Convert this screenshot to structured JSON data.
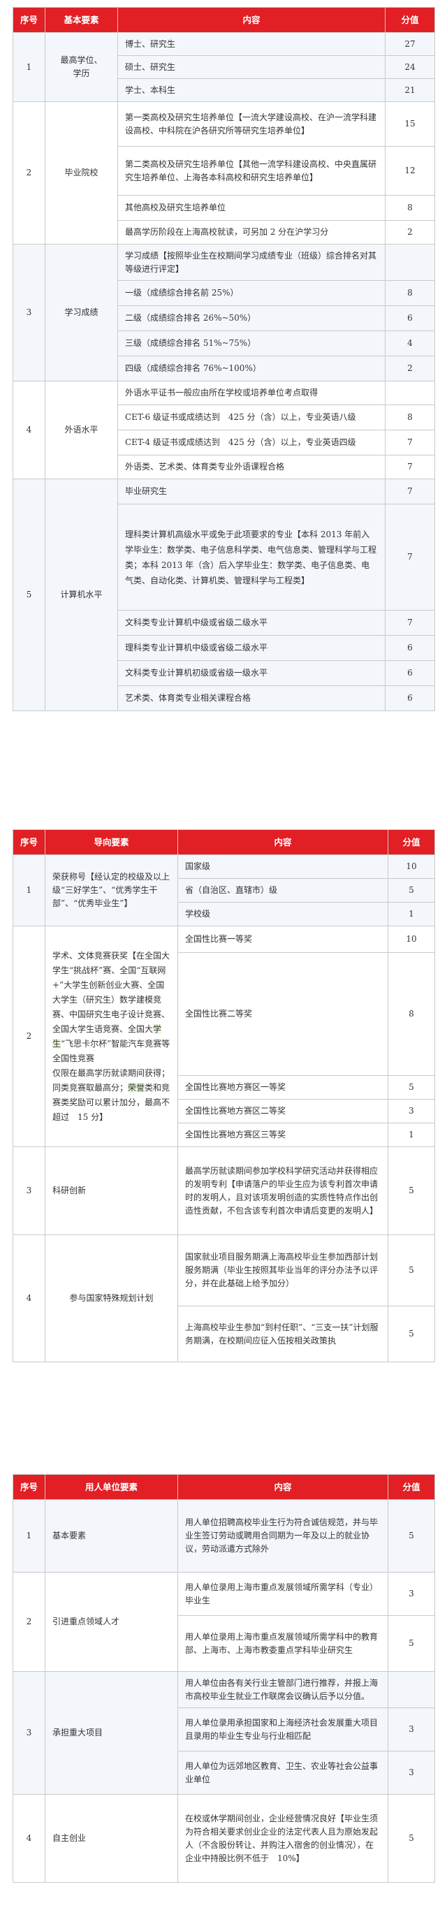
{
  "t1": {
    "headers": [
      "序号",
      "基本要素",
      "内容",
      "分值"
    ],
    "groups": [
      {
        "no": "1",
        "name": "最高学位、\n学历",
        "rows": [
          [
            "博士、研究生",
            "27"
          ],
          [
            "硕士、研究生",
            "24"
          ],
          [
            "学士、本科生",
            "21"
          ]
        ]
      },
      {
        "no": "2",
        "name": "毕业院校",
        "rows": [
          [
            "第一类高校及研究生培养单位【一流大学建设高校、在沪一流学科建设高校、中科院在沪各研究所等研究生培养单位】",
            "15"
          ],
          [
            "第二类高校及研究生培养单位【其他一流学科建设高校、中央直属研究生培养单位、上海各本科高校和研究生培养单位】",
            "12"
          ],
          [
            "其他高校及研究生培养单位",
            "8"
          ],
          [
            "最高学历阶段在上海高校就读，可另加 2 分在沪学习分",
            "2"
          ]
        ]
      },
      {
        "no": "3",
        "name": "学习成绩",
        "rows": [
          [
            "学习成绩【按照毕业生在校期间学习成绩专业（班级）综合排名对其等级进行评定】",
            ""
          ],
          [
            "一级（成绩综合排名前 25%）",
            "8"
          ],
          [
            "二级（成绩综合排名 26%~50%）",
            "6"
          ],
          [
            "三级（成绩综合排名 51%~75%）",
            "4"
          ],
          [
            "四级（成绩综合排名 76%~100%）",
            "2"
          ]
        ]
      },
      {
        "no": "4",
        "name": "外语水平",
        "rows": [
          [
            "外语水平证书一般应由所在学校或培养单位考点取得",
            ""
          ],
          [
            "CET-6 级证书或成绩达到　425 分（含）以上，专业英语八级",
            "8"
          ],
          [
            "CET-4 级证书或成绩达到　425 分（含）以上，专业英语四级",
            "7"
          ],
          [
            "外语类、艺术类、体育类专业外语课程合格",
            "7"
          ]
        ]
      },
      {
        "no": "5",
        "name": "计算机水平",
        "rows": [
          [
            "毕业研究生",
            "7"
          ],
          [
            "理科类计算机高级水平或免于此项要求的专业【本科 2013 年前入学毕业生：数学类、电子信息科学类、电气信息类、管理科学与工程类；本科 2013 年（含）后入学毕业生：数学类、电子信息类、电气类、自动化类、计算机类、管理科学与工程类】",
            "7"
          ],
          [
            "文科类专业计算机中级或省级二级水平",
            "7"
          ],
          [
            "理科类专业计算机中级或省级二级水平",
            "6"
          ],
          [
            "文科类专业计算机初级或省级一级水平",
            "6"
          ],
          [
            "艺术类、体育类专业相关课程合格",
            "6"
          ]
        ]
      }
    ]
  },
  "t2": {
    "headers": [
      "序号",
      "导向要素",
      "内容",
      "分值"
    ],
    "g1_no": "1",
    "g1_name": "荣获称号【经认定的校级及以上级“三好学生”、“优秀学生干部”、“优秀毕业生”】",
    "g1_rows": [
      [
        "国家级",
        "10"
      ],
      [
        "省（自治区、直辖市）级",
        "5"
      ],
      [
        "学校级",
        "1"
      ]
    ],
    "g2_no": "2",
    "g2_name_a": "学术、文体竞赛获奖【在全国大学生“挑战杯”赛、全国“互联网+”大学生创新创业大赛、全国大学生（研究生）数学建模竞赛、中国研究生电子设计竞赛、全国大学生",
    "g2_name_b": "语竞赛、全国大",
    "g2_name_hl1": "学生",
    "g2_name_c": "“飞思卡尔杯”智能汽车竞赛等全国性竞赛",
    "g2_name_d": "仅限在最高学历就读期间获得；同类竞赛取最高分；",
    "g2_name_hl2": "荣誉",
    "g2_name_e": "类和竞赛类奖励可以累计加分，最高不超过　15 分】",
    "g2_rows": [
      [
        "全国性比赛一等奖",
        "10"
      ],
      [
        "全国性比赛二等奖",
        "8"
      ],
      [
        "全国性比赛地方赛区一等奖",
        "5"
      ],
      [
        "全国性比赛地方赛区二等奖",
        "3"
      ],
      [
        "全国性比赛地方赛区三等奖",
        "1"
      ]
    ],
    "g3_no": "3",
    "g3_name": "科研创新",
    "g3_rows": [
      [
        "最高学历就读期间参加学校科学研究活动并获得相应的发明专利【申请落户的毕业生应为该专利首次申请时的发明人，且对该项发明创造的实质性特点作出创造性贡献，不包含该专利首次申请后变更的发明人】",
        "5"
      ]
    ],
    "g4_no": "4",
    "g4_name": "参与国家特殊规划计划",
    "g4_rows": [
      [
        "国家就业项目服务期满上海高校毕业生参加西部计划服务期满（毕业生按照其毕业当年的评分办法予以评分，并在此基础上给予加分）",
        "5"
      ],
      [
        "上海高校毕业生参加“到村任职”、“三支一扶”计划服务期满，在校期间应征入伍按相关政策执",
        "5"
      ]
    ]
  },
  "t3": {
    "headers": [
      "序号",
      "用人单位要素",
      "内容",
      "分值"
    ],
    "groups": [
      {
        "no": "1",
        "name": "基本要素",
        "rows": [
          [
            "用人单位招聘高校毕业生行为符合诚信规范，并与毕业生签订劳动或聘用合同期为一年及以上的就业协议，劳动派遣方式除外",
            "5"
          ]
        ]
      },
      {
        "no": "2",
        "name": "引进重点领域人才",
        "rows": [
          [
            "用人单位录用上海市重点发展领域所需学科（专业）毕业生",
            "3"
          ],
          [
            "用人单位录用上海市重点发展领域所需学科中的教育部、上海市、上海市教委重点学科毕业研究生",
            "5"
          ]
        ]
      },
      {
        "no": "3",
        "name": "承担重大项目",
        "rows": [
          [
            "用人单位由各有关行业主管部门进行推荐，并报上海市高校毕业生就业工作联席会议确认后予以分值。",
            ""
          ],
          [
            "用人单位录用承担国家和上海经济社会发展重大项目且录用的毕业生专业与行业相匹配",
            "3"
          ],
          [
            "用人单位为远郊地区教育、卫生、农业等社会公益事业单位",
            "3"
          ]
        ]
      },
      {
        "no": "4",
        "name": "自主创业",
        "rows": [
          [
            "在校或休学期间创业，企业经营情况良好【毕业生须为符合相关要求创业企业的法定代表人且为原始发起人（不含股份转让、并购注入宿舍的创业情况），在企业中持股比例不低于　10%】",
            "5"
          ]
        ]
      }
    ]
  }
}
